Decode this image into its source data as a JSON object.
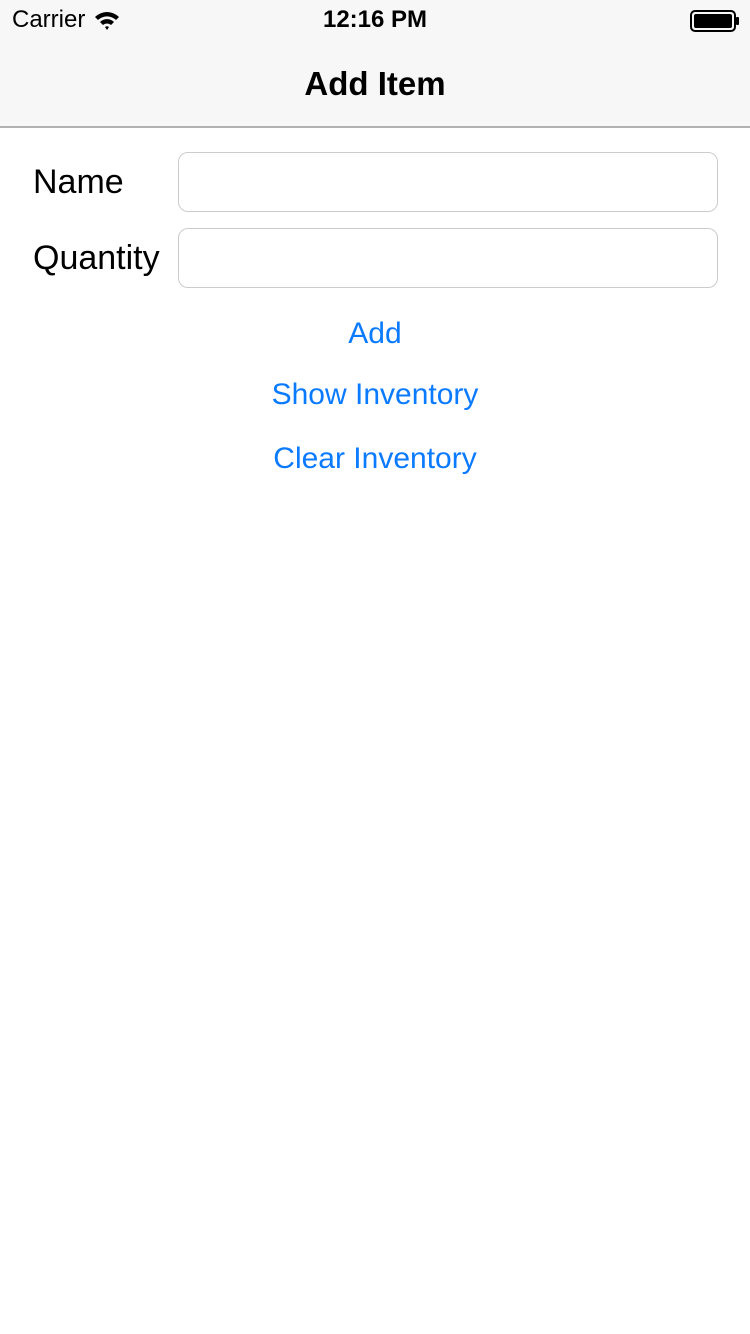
{
  "status_bar": {
    "carrier": "Carrier",
    "time": "12:16 PM",
    "wifi_icon": "wifi-icon",
    "battery_icon": "battery-icon"
  },
  "nav": {
    "title": "Add Item"
  },
  "form": {
    "name_label": "Name",
    "name_value": "",
    "name_placeholder": "",
    "quantity_label": "Quantity",
    "quantity_value": "",
    "quantity_placeholder": ""
  },
  "actions": {
    "add_label": "Add",
    "show_inventory_label": "Show Inventory",
    "clear_inventory_label": "Clear Inventory"
  },
  "colors": {
    "accent": "#0a7aff",
    "nav_background": "#f7f7f7"
  }
}
